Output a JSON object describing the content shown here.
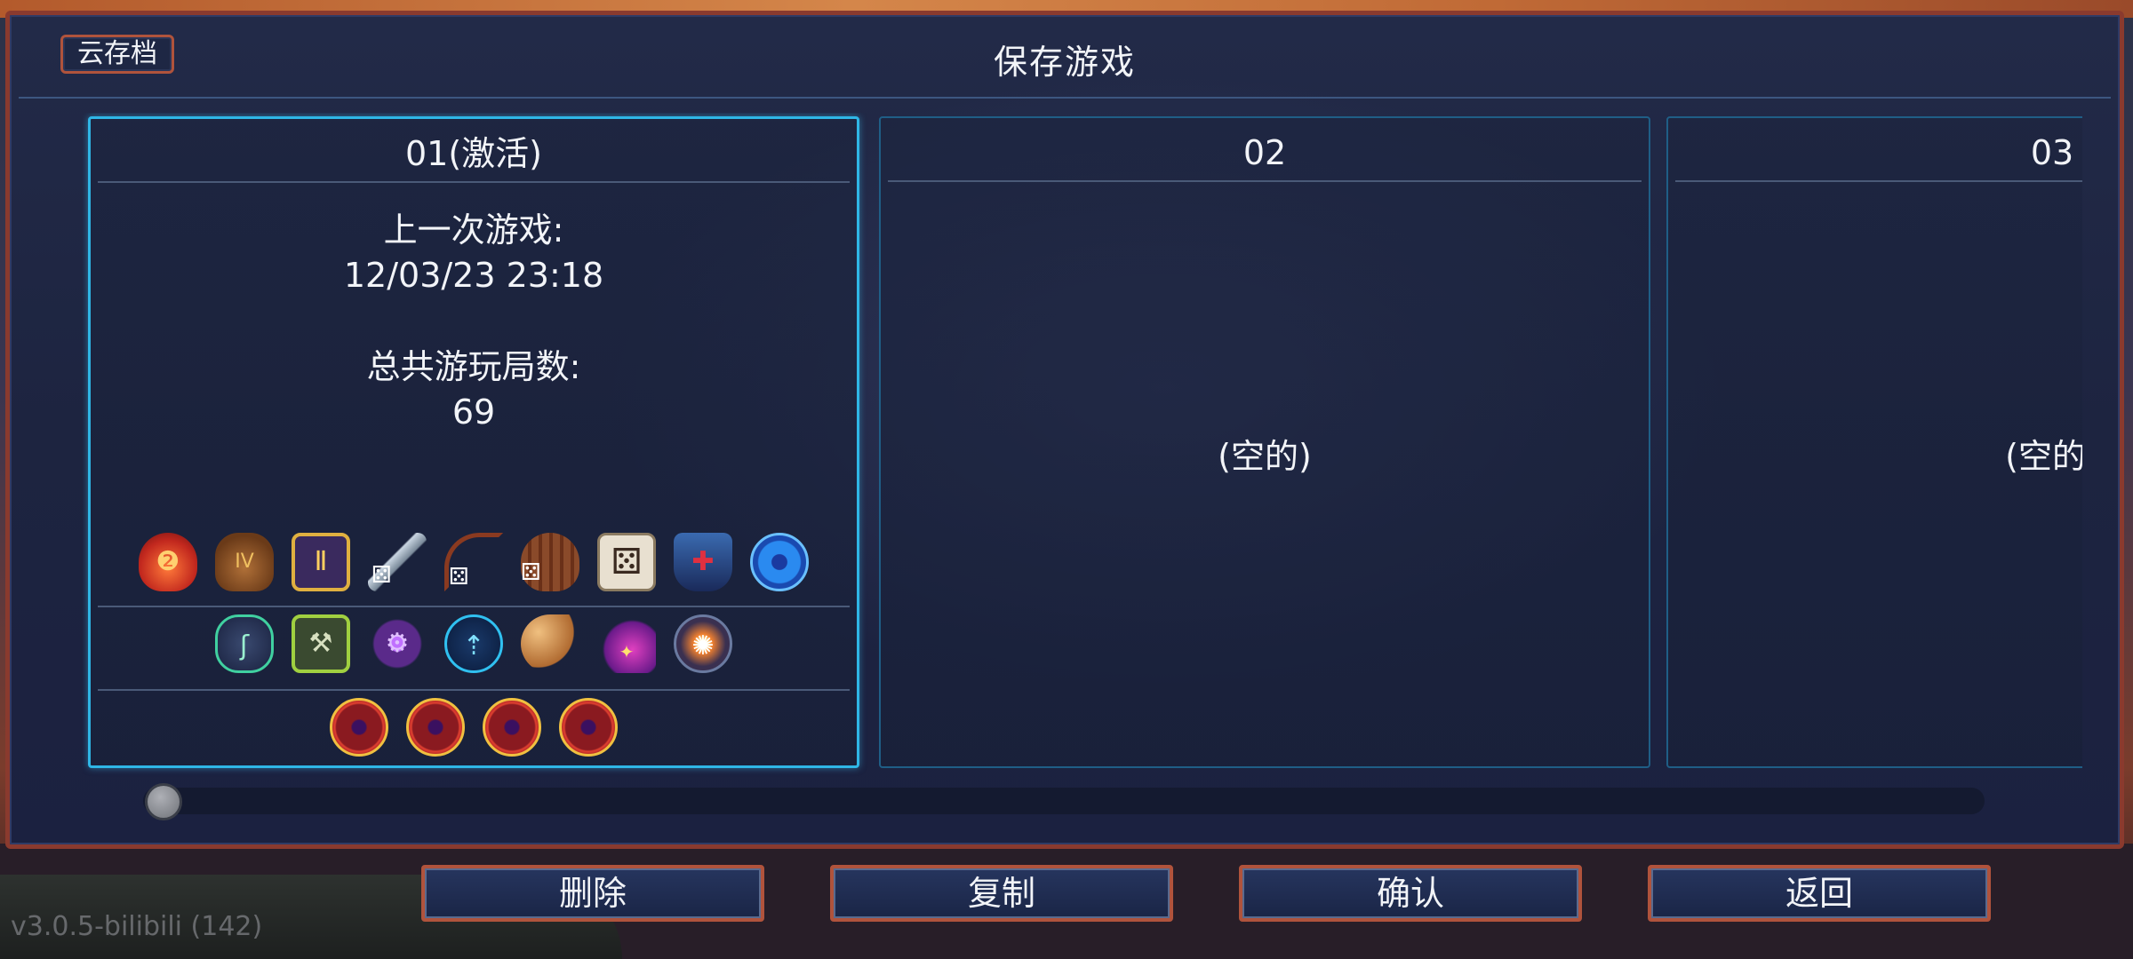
{
  "dialog": {
    "title": "保存游戏",
    "cloud_button": "云存档"
  },
  "slots": [
    {
      "header": "01(激活)",
      "active": true,
      "last_played_label": "上一次游戏:",
      "last_played_value": "12/03/23  23:18",
      "total_runs_label": "总共游玩局数:",
      "total_runs_value": "69",
      "items_row1": [
        "red-potion-icon",
        "loot-bag-icon",
        "scroll-ii-icon",
        "sword-dice-icon",
        "bow-dice-icon",
        "shield-dice-icon",
        "dice-icon",
        "dark-shield-icon",
        "blue-eye-orb-icon"
      ],
      "items_row2": [
        "green-rune-icon",
        "wrench-rune-icon",
        "purple-gear-icon",
        "blue-teleport-icon",
        "horn-icon",
        "purple-comet-icon",
        "spark-orb-icon"
      ],
      "items_row3": [
        "red-eye-emblem-icon",
        "red-eye-emblem-icon",
        "red-eye-emblem-icon",
        "red-eye-emblem-icon"
      ]
    },
    {
      "header": "02",
      "active": false,
      "empty_text": "(空的)"
    },
    {
      "header": "03",
      "active": false,
      "empty_text": "(空的)"
    }
  ],
  "scroll_position": 0,
  "buttons": {
    "delete": "删除",
    "copy": "复制",
    "confirm": "确认",
    "back": "返回"
  },
  "version": "v3.0.5-bilibili (142)",
  "colors": {
    "frame": "#8a3a2e",
    "active_border": "#2fb6e6",
    "panel": "#1d2440"
  }
}
